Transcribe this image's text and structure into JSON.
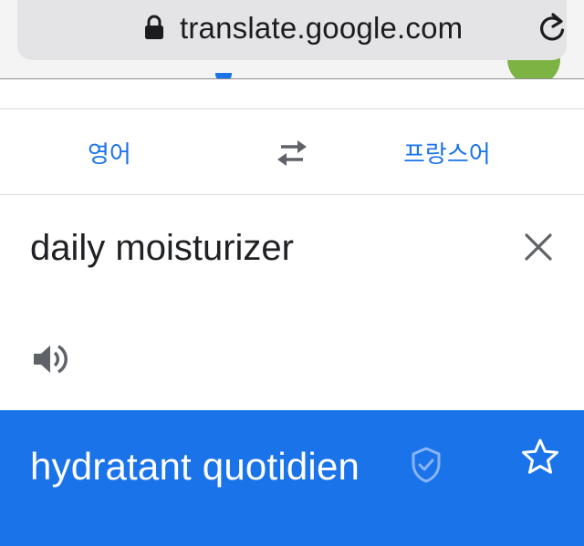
{
  "browser": {
    "url": "translate.google.com",
    "icons": {
      "lock": "lock-icon",
      "reload": "reload-icon"
    }
  },
  "language_bar": {
    "source_language": "영어",
    "target_language": "프랑스어",
    "swap_icon": "swap-icon"
  },
  "input": {
    "text": "daily moisturizer",
    "clear_icon": "close-icon",
    "listen_icon": "speaker-icon"
  },
  "result": {
    "text": "hydratant quotidien",
    "verified_icon": "verified-shield-icon",
    "save_icon": "star-icon"
  },
  "colors": {
    "accent": "#1a73e8",
    "text_primary": "#202124",
    "result_text": "#ffffff",
    "icon_gray": "#5f6368"
  }
}
